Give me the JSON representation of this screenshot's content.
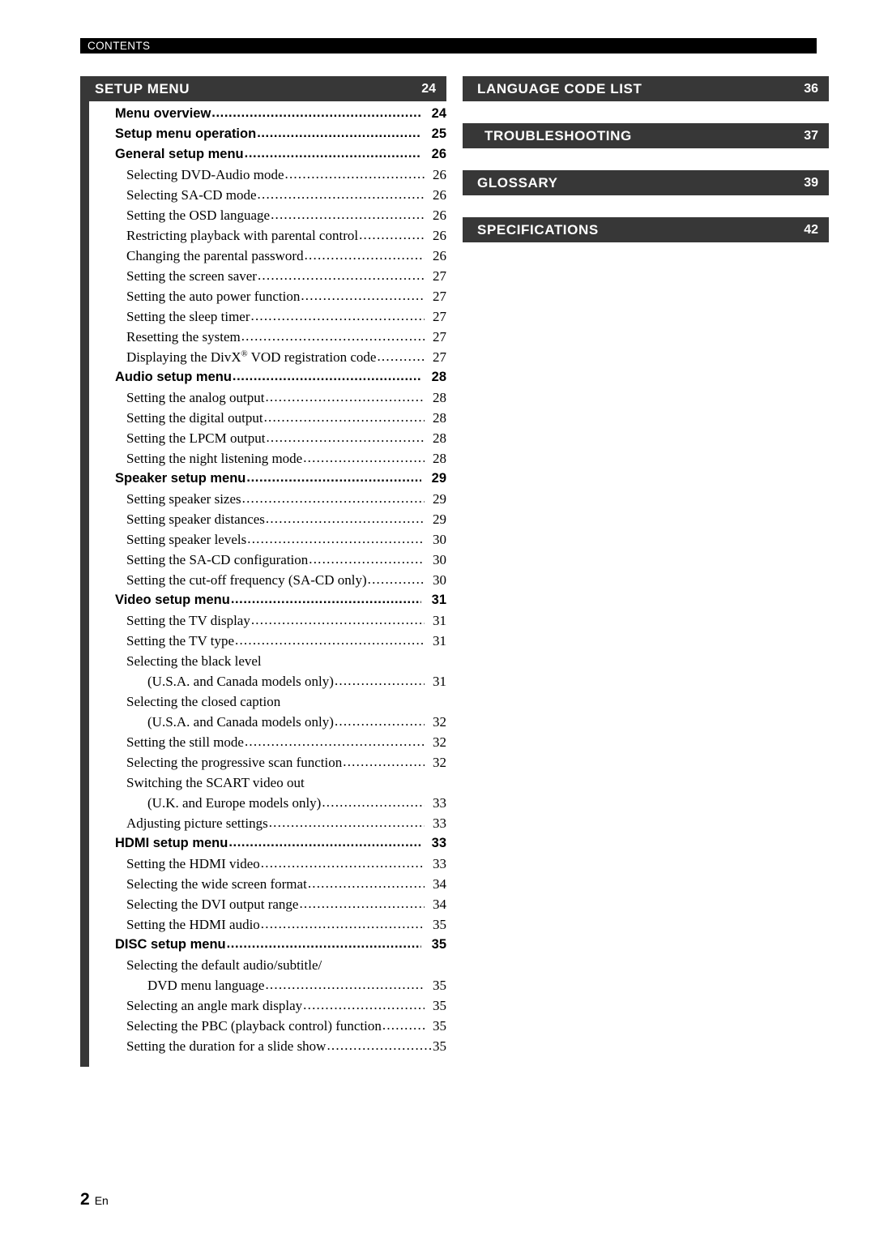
{
  "running_head": {
    "label": "CONTENTS"
  },
  "footer": {
    "page_number": "2",
    "language_code": "En"
  },
  "colors": {
    "bar": "#373737",
    "running_head_bar": "#000000",
    "text": "#000000"
  },
  "left_column": {
    "section": {
      "title": "SETUP MENU",
      "page": "24"
    },
    "entries": [
      {
        "level": 1,
        "text": "Menu overview",
        "page": "24"
      },
      {
        "level": 1,
        "text": "Setup menu operation",
        "page": "25"
      },
      {
        "level": 1,
        "text": "General setup menu",
        "page": "26"
      },
      {
        "level": 2,
        "text": "Selecting DVD-Audio mode",
        "page": "26"
      },
      {
        "level": 2,
        "text": "Selecting SA-CD mode",
        "page": "26"
      },
      {
        "level": 2,
        "text": "Setting the OSD language",
        "page": "26"
      },
      {
        "level": 2,
        "text": "Restricting playback with parental control",
        "page": "26"
      },
      {
        "level": 2,
        "text": "Changing the parental password",
        "page": "26"
      },
      {
        "level": 2,
        "text": "Setting the screen saver",
        "page": "27"
      },
      {
        "level": 2,
        "text": "Setting the auto power function",
        "page": "27"
      },
      {
        "level": 2,
        "text": "Setting the sleep timer",
        "page": "27"
      },
      {
        "level": 2,
        "text": "Resetting the system",
        "page": "27"
      },
      {
        "level": 2,
        "text": "Displaying the DivX® VOD registration code",
        "page": "27"
      },
      {
        "level": 1,
        "text": "Audio setup menu",
        "page": "28"
      },
      {
        "level": 2,
        "text": "Setting the analog output",
        "page": "28"
      },
      {
        "level": 2,
        "text": "Setting the digital output",
        "page": "28"
      },
      {
        "level": 2,
        "text": "Setting the LPCM output",
        "page": "28"
      },
      {
        "level": 2,
        "text": "Setting the night listening mode",
        "page": "28"
      },
      {
        "level": 1,
        "text": "Speaker setup menu",
        "page": "29"
      },
      {
        "level": 2,
        "text": "Setting speaker sizes",
        "page": "29"
      },
      {
        "level": 2,
        "text": "Setting speaker distances",
        "page": "29"
      },
      {
        "level": 2,
        "text": "Setting speaker levels",
        "page": "30"
      },
      {
        "level": 2,
        "text": "Setting the SA-CD configuration",
        "page": "30"
      },
      {
        "level": 2,
        "text": "Setting the cut-off frequency (SA-CD only)",
        "page": "30"
      },
      {
        "level": 1,
        "text": "Video setup menu",
        "page": "31"
      },
      {
        "level": 2,
        "text": "Setting the TV display",
        "page": "31"
      },
      {
        "level": 2,
        "text": "Setting the TV type",
        "page": "31"
      },
      {
        "level": 2,
        "text": "Selecting the black level",
        "page": "",
        "no_leader": true
      },
      {
        "level": 3,
        "text": "(U.S.A. and Canada models only)",
        "page": "31"
      },
      {
        "level": 2,
        "text": "Selecting the closed caption",
        "page": "",
        "no_leader": true
      },
      {
        "level": 3,
        "text": "(U.S.A. and Canada models only)",
        "page": "32"
      },
      {
        "level": 2,
        "text": "Setting the still mode",
        "page": "32"
      },
      {
        "level": 2,
        "text": "Selecting the progressive scan function",
        "page": "32"
      },
      {
        "level": 2,
        "text": "Switching the SCART video out",
        "page": "",
        "no_leader": true
      },
      {
        "level": 3,
        "text": "(U.K. and Europe models only)",
        "page": "33"
      },
      {
        "level": 2,
        "text": "Adjusting picture settings",
        "page": "33"
      },
      {
        "level": 1,
        "text": "HDMI setup menu",
        "page": "33"
      },
      {
        "level": 2,
        "text": "Setting the HDMI video",
        "page": "33"
      },
      {
        "level": 2,
        "text": "Selecting the wide screen format",
        "page": "34"
      },
      {
        "level": 2,
        "text": "Selecting the DVI output range",
        "page": "34"
      },
      {
        "level": 2,
        "text": "Setting the HDMI audio",
        "page": "35"
      },
      {
        "level": 1,
        "text": "DISC setup menu",
        "page": "35"
      },
      {
        "level": 2,
        "text": "Selecting the default audio/subtitle/",
        "page": "",
        "no_leader": true
      },
      {
        "level": 3,
        "text": "DVD menu language",
        "page": "35"
      },
      {
        "level": 2,
        "text": "Selecting an angle mark display",
        "page": "35"
      },
      {
        "level": 2,
        "text": "Selecting the PBC (playback control) function",
        "page": "35"
      },
      {
        "level": 2,
        "text": "Setting the duration for a slide show",
        "page": "35",
        "tight": true
      }
    ]
  },
  "right_column": {
    "sections": [
      {
        "title": "LANGUAGE CODE LIST",
        "page": "36",
        "indented": false
      },
      {
        "title": "TROUBLESHOOTING",
        "page": "37",
        "indented": true
      },
      {
        "title": "GLOSSARY",
        "page": "39",
        "indented": false
      },
      {
        "title": "SPECIFICATIONS",
        "page": "42",
        "indented": false
      }
    ]
  }
}
